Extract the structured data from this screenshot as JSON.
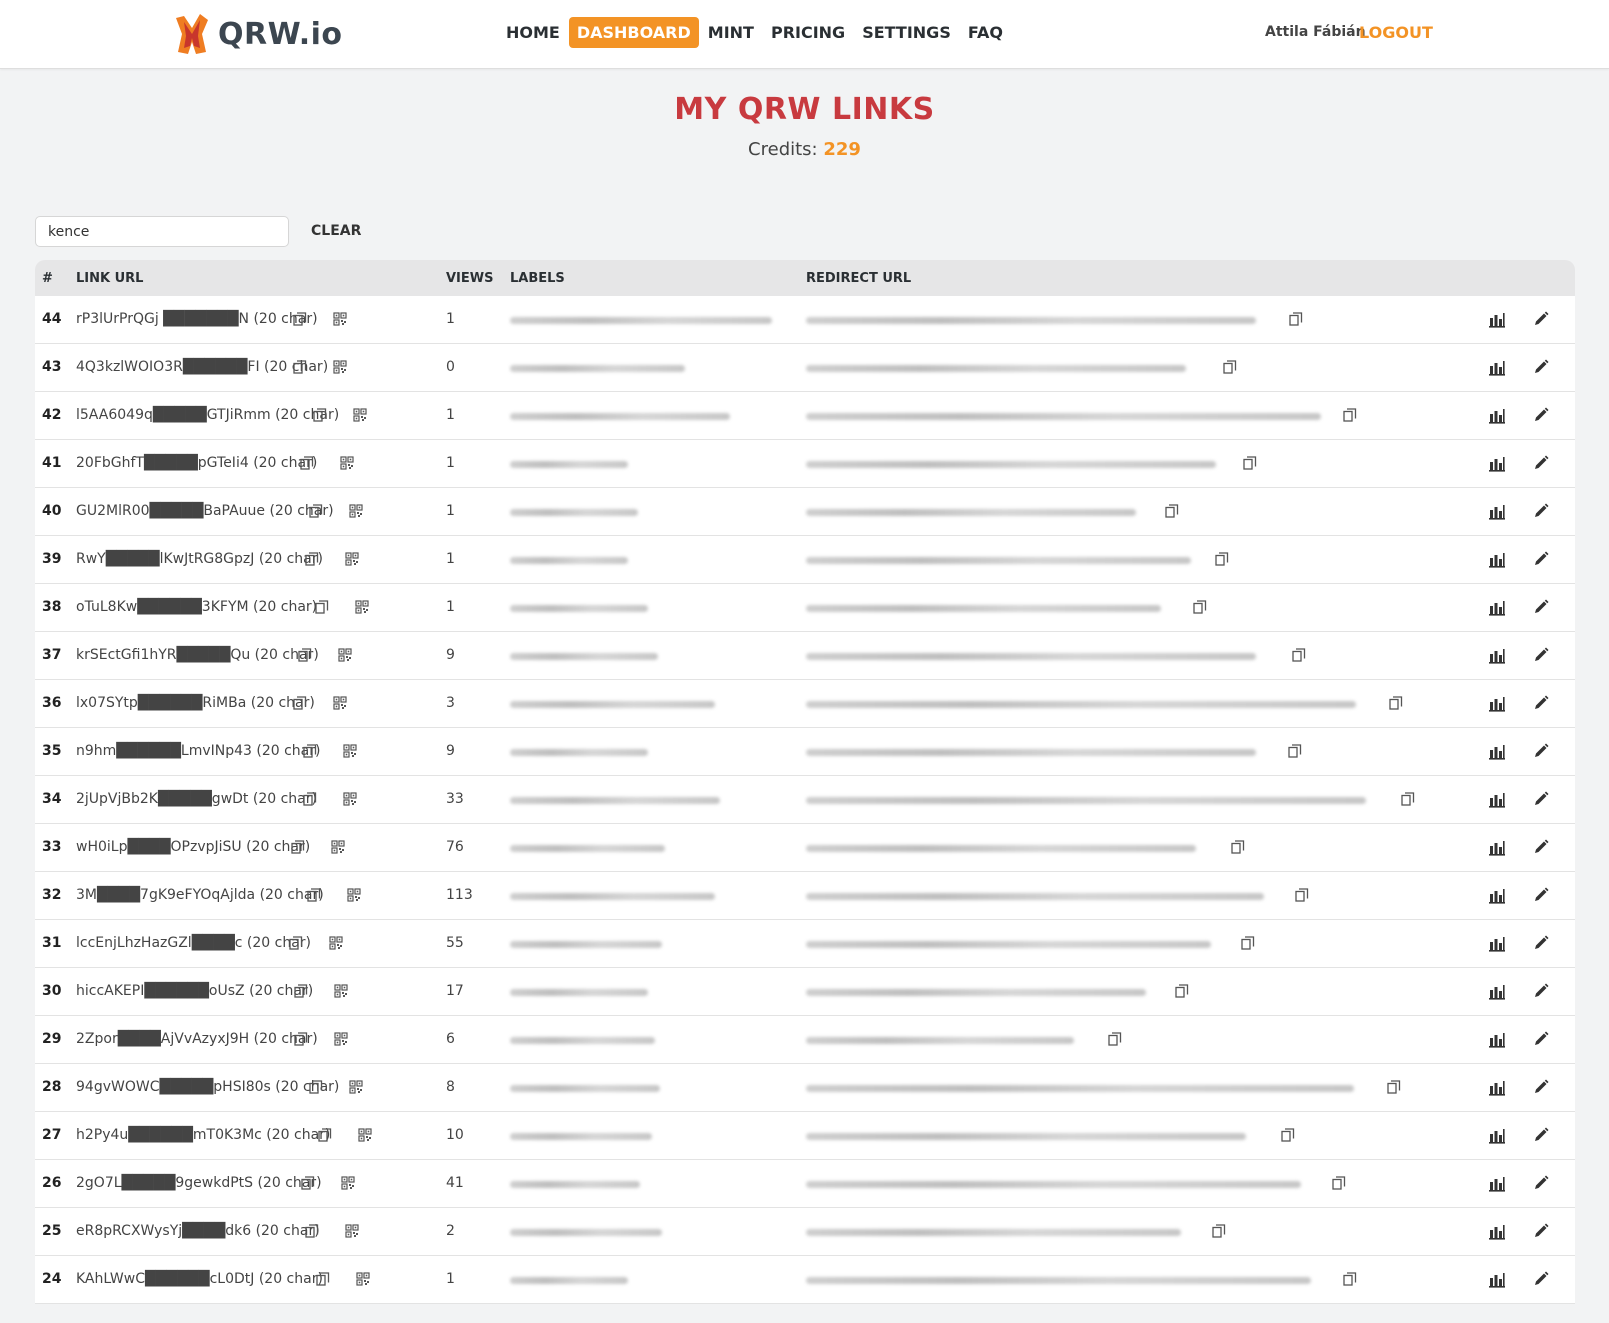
{
  "header": {
    "logo_text": "QRW.io",
    "nav": [
      {
        "label": "HOME",
        "active": false
      },
      {
        "label": "DASHBOARD",
        "active": true
      },
      {
        "label": "MINT",
        "active": false
      },
      {
        "label": "PRICING",
        "active": false
      },
      {
        "label": "SETTINGS",
        "active": false
      },
      {
        "label": "FAQ",
        "active": false
      }
    ],
    "user_name": "Attila Fábián",
    "logout_label": "LOGOUT"
  },
  "page": {
    "title": "MY QRW LINKS",
    "credits_label": "Credits:",
    "credits_value": "229"
  },
  "search": {
    "value": "kence",
    "clear_label": "CLEAR"
  },
  "table": {
    "headers": {
      "num": "#",
      "link_url": "LINK URL",
      "views": "VIEWS",
      "labels": "LABELS",
      "redirect_url": "REDIRECT URL"
    },
    "rows": [
      {
        "num": "44",
        "link": "rP3lUrPrQGj ███████N (20 char)",
        "views": "1"
      },
      {
        "num": "43",
        "link": "4Q3kzlWOIO3R██████FI (20 char)",
        "views": "0"
      },
      {
        "num": "42",
        "link": "l5AA6049q█████GTJiRmm (20 char)",
        "views": "1"
      },
      {
        "num": "41",
        "link": "20FbGhfT█████pGTeIi4 (20 char)",
        "views": "1"
      },
      {
        "num": "40",
        "link": "GU2MlR00█████BaPAuue (20 char)",
        "views": "1"
      },
      {
        "num": "39",
        "link": "RwY█████lKwJtRG8GpzJ (20 char)",
        "views": "1"
      },
      {
        "num": "38",
        "link": "oTuL8Kw██████3KFYM (20 char)",
        "views": "1"
      },
      {
        "num": "37",
        "link": "krSEctGfi1hYR█████Qu (20 char)",
        "views": "9"
      },
      {
        "num": "36",
        "link": "lx07SYtp██████RiMBa (20 char)",
        "views": "3"
      },
      {
        "num": "35",
        "link": "n9hm██████LmvINp43 (20 char)",
        "views": "9"
      },
      {
        "num": "34",
        "link": "2jUpVjBb2K█████gwDt (20 char)",
        "views": "33"
      },
      {
        "num": "33",
        "link": "wH0iLp████OPzvpJiSU (20 char)",
        "views": "76"
      },
      {
        "num": "32",
        "link": "3M████7gK9eFYOqAjlda (20 char)",
        "views": "113"
      },
      {
        "num": "31",
        "link": "lccEnjLhzHazGZl████c (20 char)",
        "views": "55"
      },
      {
        "num": "30",
        "link": "hiccAKEPI██████oUsZ (20 char)",
        "views": "17"
      },
      {
        "num": "29",
        "link": "2Zpor████AjVvAzyxJ9H (20 char)",
        "views": "6"
      },
      {
        "num": "28",
        "link": "94gvWOWC█████pHSI80s (20 char)",
        "views": "8"
      },
      {
        "num": "27",
        "link": "h2Py4u██████mT0K3Mc (20 char)",
        "views": "10"
      },
      {
        "num": "26",
        "link": "2gO7L█████9gewkdPtS (20 char)",
        "views": "41"
      },
      {
        "num": "25",
        "link": "eR8pRCXWysYj████dk6 (20 char)",
        "views": "2"
      },
      {
        "num": "24",
        "link": "KAhLWwC██████cL0DtJ (20 char)",
        "views": "1"
      }
    ]
  },
  "colors": {
    "accent": "#f39325",
    "title": "#c83a3f"
  },
  "icons": {
    "copy": "copy-icon",
    "qr": "qr-code-icon",
    "stats": "bar-chart-icon",
    "edit": "pencil-icon"
  }
}
